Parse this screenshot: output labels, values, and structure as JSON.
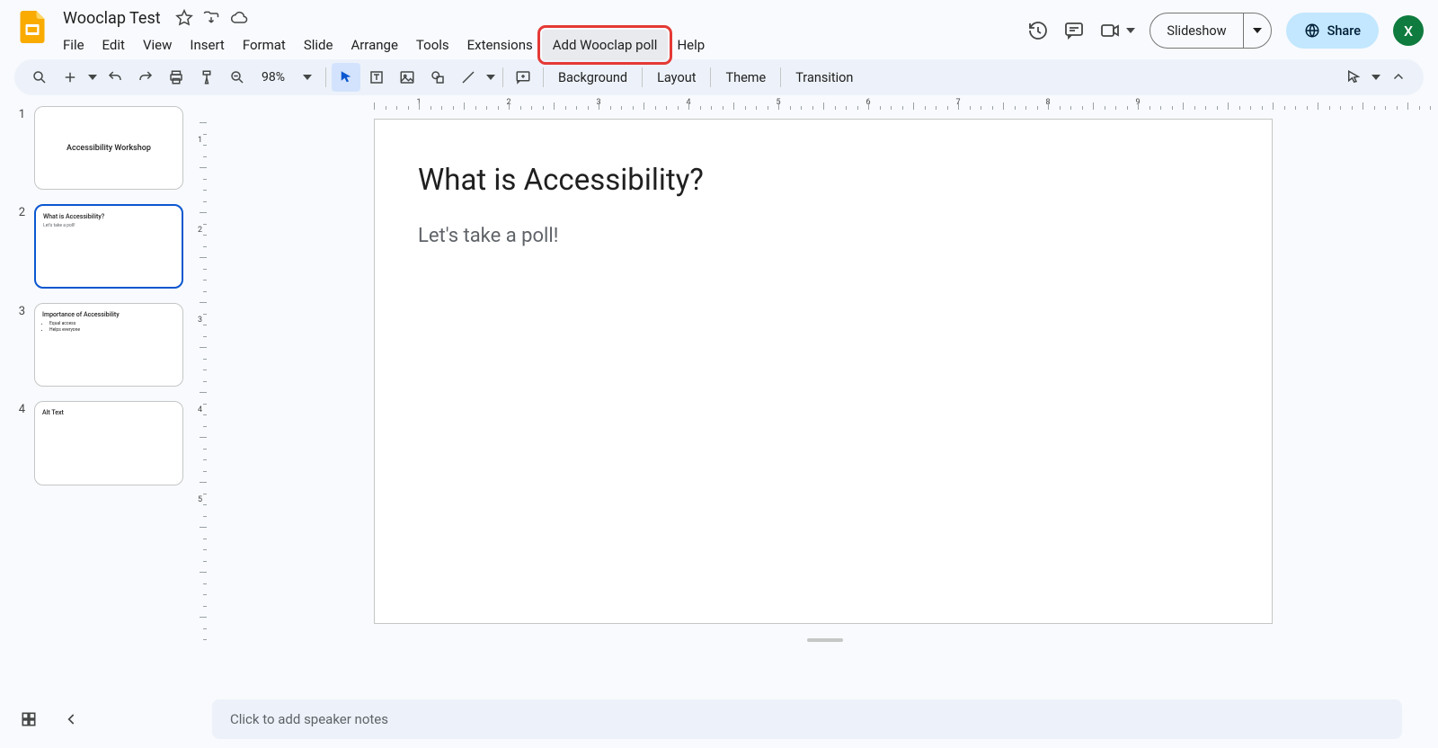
{
  "doc": {
    "title": "Wooclap Test"
  },
  "menu": {
    "file": "File",
    "edit": "Edit",
    "view": "View",
    "insert": "Insert",
    "format": "Format",
    "slide": "Slide",
    "arrange": "Arrange",
    "tools": "Tools",
    "extensions": "Extensions",
    "wooclap": "Add Wooclap poll",
    "help": "Help"
  },
  "header": {
    "slideshow": "Slideshow",
    "share": "Share",
    "avatar": "X"
  },
  "toolbar": {
    "zoom": "98%",
    "background": "Background",
    "layout": "Layout",
    "theme": "Theme",
    "transition": "Transition"
  },
  "filmstrip": [
    {
      "num": "1",
      "type": "title",
      "title": "Accessibility Workshop"
    },
    {
      "num": "2",
      "type": "content",
      "title": "What is Accessibility?",
      "sub": "Let's take a poll!",
      "selected": true
    },
    {
      "num": "3",
      "type": "bullets",
      "title": "Importance of Accessibility",
      "bullets": [
        "Equal access",
        "Helps everyone"
      ]
    },
    {
      "num": "4",
      "type": "content",
      "title": "Alt Text",
      "sub": ""
    }
  ],
  "slide": {
    "title": "What is Accessibility?",
    "body": "Let's take a poll!"
  },
  "ruler_h": [
    "1",
    "2",
    "3",
    "4",
    "5",
    "6",
    "7",
    "8",
    "9"
  ],
  "ruler_v": [
    "1",
    "2",
    "3",
    "4",
    "5"
  ],
  "notes": {
    "placeholder": "Click to add speaker notes"
  }
}
